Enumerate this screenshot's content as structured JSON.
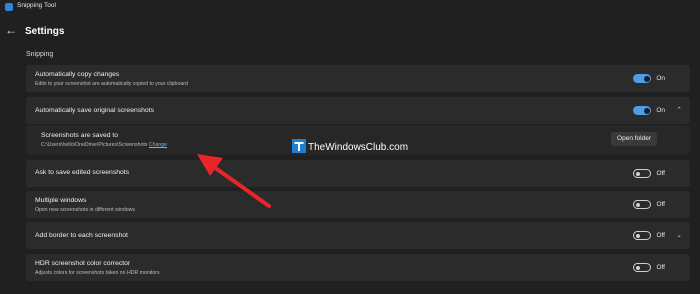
{
  "titlebar": {
    "title": "Snipping Tool"
  },
  "header": {
    "back_icon": "back-arrow-icon",
    "title": "Settings"
  },
  "section": {
    "label": "Snipping"
  },
  "rows": {
    "copy": {
      "title": "Automatically copy changes",
      "desc": "Edits to your screenshot are automatically copied to your clipboard",
      "state": "On"
    },
    "save": {
      "title": "Automatically save original screenshots",
      "state": "On"
    },
    "saved": {
      "title": "Screenshots are saved to",
      "path": "C:\\Users\\hello\\OneDrive\\Pictures\\Screenshots",
      "link": "Change",
      "button": "Open folder"
    },
    "ask": {
      "title": "Ask to save edited screenshots",
      "state": "Off"
    },
    "multi": {
      "title": "Multiple windows",
      "desc": "Open new screenshots in different windows",
      "state": "Off"
    },
    "border": {
      "title": "Add border to each screenshot",
      "state": "Off"
    },
    "hdr": {
      "title": "HDR screenshot color corrector",
      "desc": "Adjusts colors for screenshots taken on HDR monitors",
      "state": "Off"
    }
  },
  "watermark": {
    "text": "TheWindowsClub.com"
  },
  "colors": {
    "accent": "#4aa0e8",
    "arrow": "#e8262a",
    "background": "#202020",
    "card": "#2b2b2b",
    "link": "#69b9f5"
  }
}
